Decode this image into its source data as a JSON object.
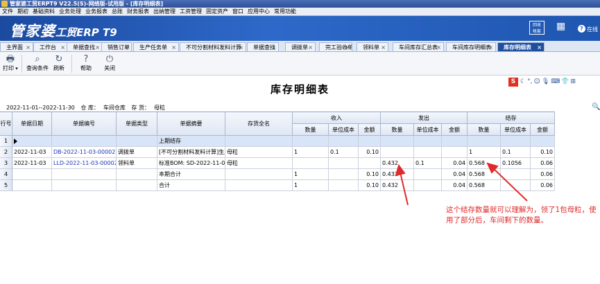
{
  "window": {
    "title": "管家婆工贸ERPT9 V22.5(S)-网络版-试用版 - [库存明细表]"
  },
  "menu": [
    "文件",
    "期初",
    "基础资料",
    "业务处理",
    "业务报表",
    "总账",
    "财务报表",
    "出纳管理",
    "工资管理",
    "固定资产",
    "窗口",
    "应用中心",
    "常用功能"
  ],
  "banner": {
    "logo_main": "管家婆",
    "logo_sub": "工贸ERP T9",
    "msg_line1": "回收",
    "msg_line2": "帐套",
    "online": "在线"
  },
  "tabs": [
    {
      "label": "主界面"
    },
    {
      "label": "工作台"
    },
    {
      "label": "单据查找"
    },
    {
      "label": "销售订单"
    },
    {
      "label": "生产任务单"
    },
    {
      "label": "不可分割材料发料计算"
    },
    {
      "label": "单据查找"
    },
    {
      "label": "调拨单"
    },
    {
      "label": "完工验收单"
    },
    {
      "label": "领料单"
    },
    {
      "label": "车间库存汇总表"
    },
    {
      "label": "车间库存明细表"
    },
    {
      "label": "库存明细表"
    }
  ],
  "toolbar": {
    "print": "打印",
    "query": "查询条件",
    "refresh": "刷新",
    "help": "帮助",
    "close": "关闭"
  },
  "report": {
    "title": "库存明细表",
    "date_range": "2022-11-01--2022-11-30",
    "warehouse_label": "仓  库：",
    "warehouse": "车间仓库",
    "goods_label": "存  货：",
    "goods": "母粒"
  },
  "table": {
    "headers": {
      "rownum": "行号",
      "date": "单据日期",
      "no": "单据编号",
      "type": "单据类型",
      "summary": "单据摘要",
      "goods": "存货全名",
      "in": "收入",
      "out": "发出",
      "bal": "结存",
      "qty": "数量",
      "cost": "单位成本",
      "amt": "金额"
    },
    "rows": [
      {
        "n": "1",
        "date": "",
        "no": "",
        "type": "",
        "summary": "上期结存",
        "goods": "",
        "in_qty": "",
        "in_cost": "",
        "in_amt": "",
        "out_qty": "",
        "out_cost": "",
        "out_amt": "",
        "bal_qty": "",
        "bal_cost": "",
        "bal_amt": ""
      },
      {
        "n": "2",
        "date": "2022-11-03",
        "no": "DB-2022-11-03-00002",
        "type": "调拨单",
        "summary": "[不可分割材料发料计算]生成",
        "goods": "母粒",
        "in_qty": "1",
        "in_cost": "0.1",
        "in_amt": "0.10",
        "out_qty": "",
        "out_cost": "",
        "out_amt": "",
        "bal_qty": "1",
        "bal_cost": "0.1",
        "bal_amt": "0.10"
      },
      {
        "n": "3",
        "date": "2022-11-03",
        "no": "LLD-2022-11-03-00002",
        "type": "领料单",
        "summary": "标准BOM: SD-2022-11-03-00",
        "goods": "母粒",
        "in_qty": "",
        "in_cost": "",
        "in_amt": "",
        "out_qty": "0.432",
        "out_cost": "0.1",
        "out_amt": "0.04",
        "bal_qty": "0.568",
        "bal_cost": "0.1056",
        "bal_amt": "0.06"
      },
      {
        "n": "4",
        "date": "",
        "no": "",
        "type": "",
        "summary": "本期合计",
        "goods": "",
        "in_qty": "1",
        "in_cost": "",
        "in_amt": "0.10",
        "out_qty": "0.432",
        "out_cost": "",
        "out_amt": "0.04",
        "bal_qty": "0.568",
        "bal_cost": "",
        "bal_amt": "0.06"
      },
      {
        "n": "5",
        "date": "",
        "no": "",
        "type": "",
        "summary": "合计",
        "goods": "",
        "in_qty": "1",
        "in_cost": "",
        "in_amt": "0.10",
        "out_qty": "0.432",
        "out_cost": "",
        "out_amt": "0.04",
        "bal_qty": "0.568",
        "bal_cost": "",
        "bal_amt": "0.06"
      }
    ]
  },
  "annotation": "这个结存数量就可以理解为，领了1包母粒，使用了部分后，车间剩下的数量。",
  "colors": {
    "annotation": "#e02a2a",
    "doc_link": "#1a35b8",
    "active_tab": "#1e4e9e"
  }
}
